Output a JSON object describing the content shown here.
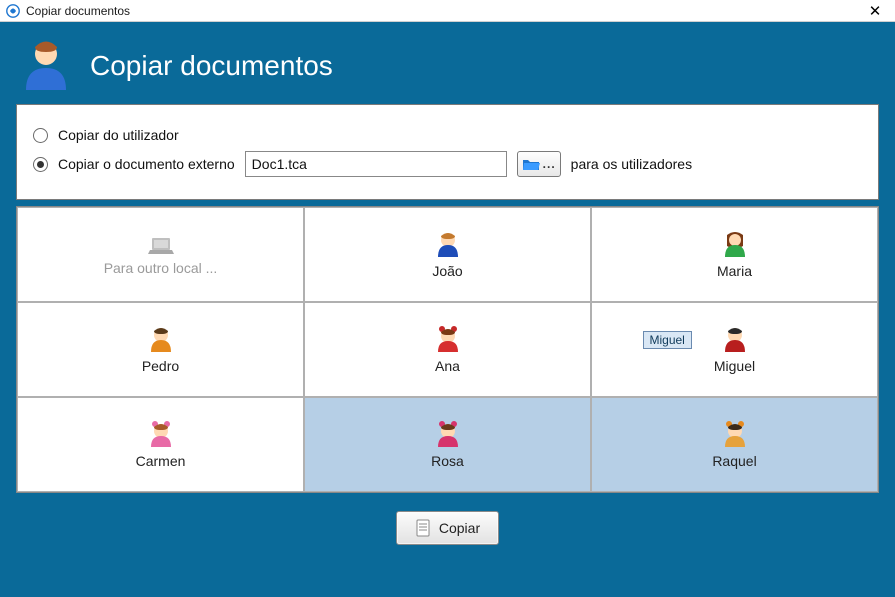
{
  "window": {
    "title": "Copiar documentos",
    "close_glyph": "✕"
  },
  "header": {
    "title": "Copiar documentos"
  },
  "options": {
    "from_user": {
      "label": "Copiar do utilizador",
      "selected": false
    },
    "from_external": {
      "label": "Copiar o documento externo",
      "selected": true,
      "file_value": "Doc1.tca",
      "browse_ellipsis": "...",
      "suffix": "para os utilizadores"
    }
  },
  "targets": {
    "other_location_label": "Para outro local ...",
    "users": [
      {
        "name": "João",
        "avatar": "boy-blue",
        "selected": false
      },
      {
        "name": "Maria",
        "avatar": "woman-green",
        "selected": false
      },
      {
        "name": "Pedro",
        "avatar": "boy-orange",
        "selected": false
      },
      {
        "name": "Ana",
        "avatar": "girl-red",
        "selected": false
      },
      {
        "name": "Miguel",
        "avatar": "boy-red",
        "selected": false,
        "tooltip": "Miguel"
      },
      {
        "name": "Carmen",
        "avatar": "girl-pink",
        "selected": false
      },
      {
        "name": "Rosa",
        "avatar": "girl-magenta",
        "selected": true
      },
      {
        "name": "Raquel",
        "avatar": "girl-orange",
        "selected": true
      }
    ]
  },
  "actions": {
    "copy_label": "Copiar"
  },
  "colors": {
    "content_bg": "#0a6a99",
    "selected_bg": "#b6cfe6"
  }
}
